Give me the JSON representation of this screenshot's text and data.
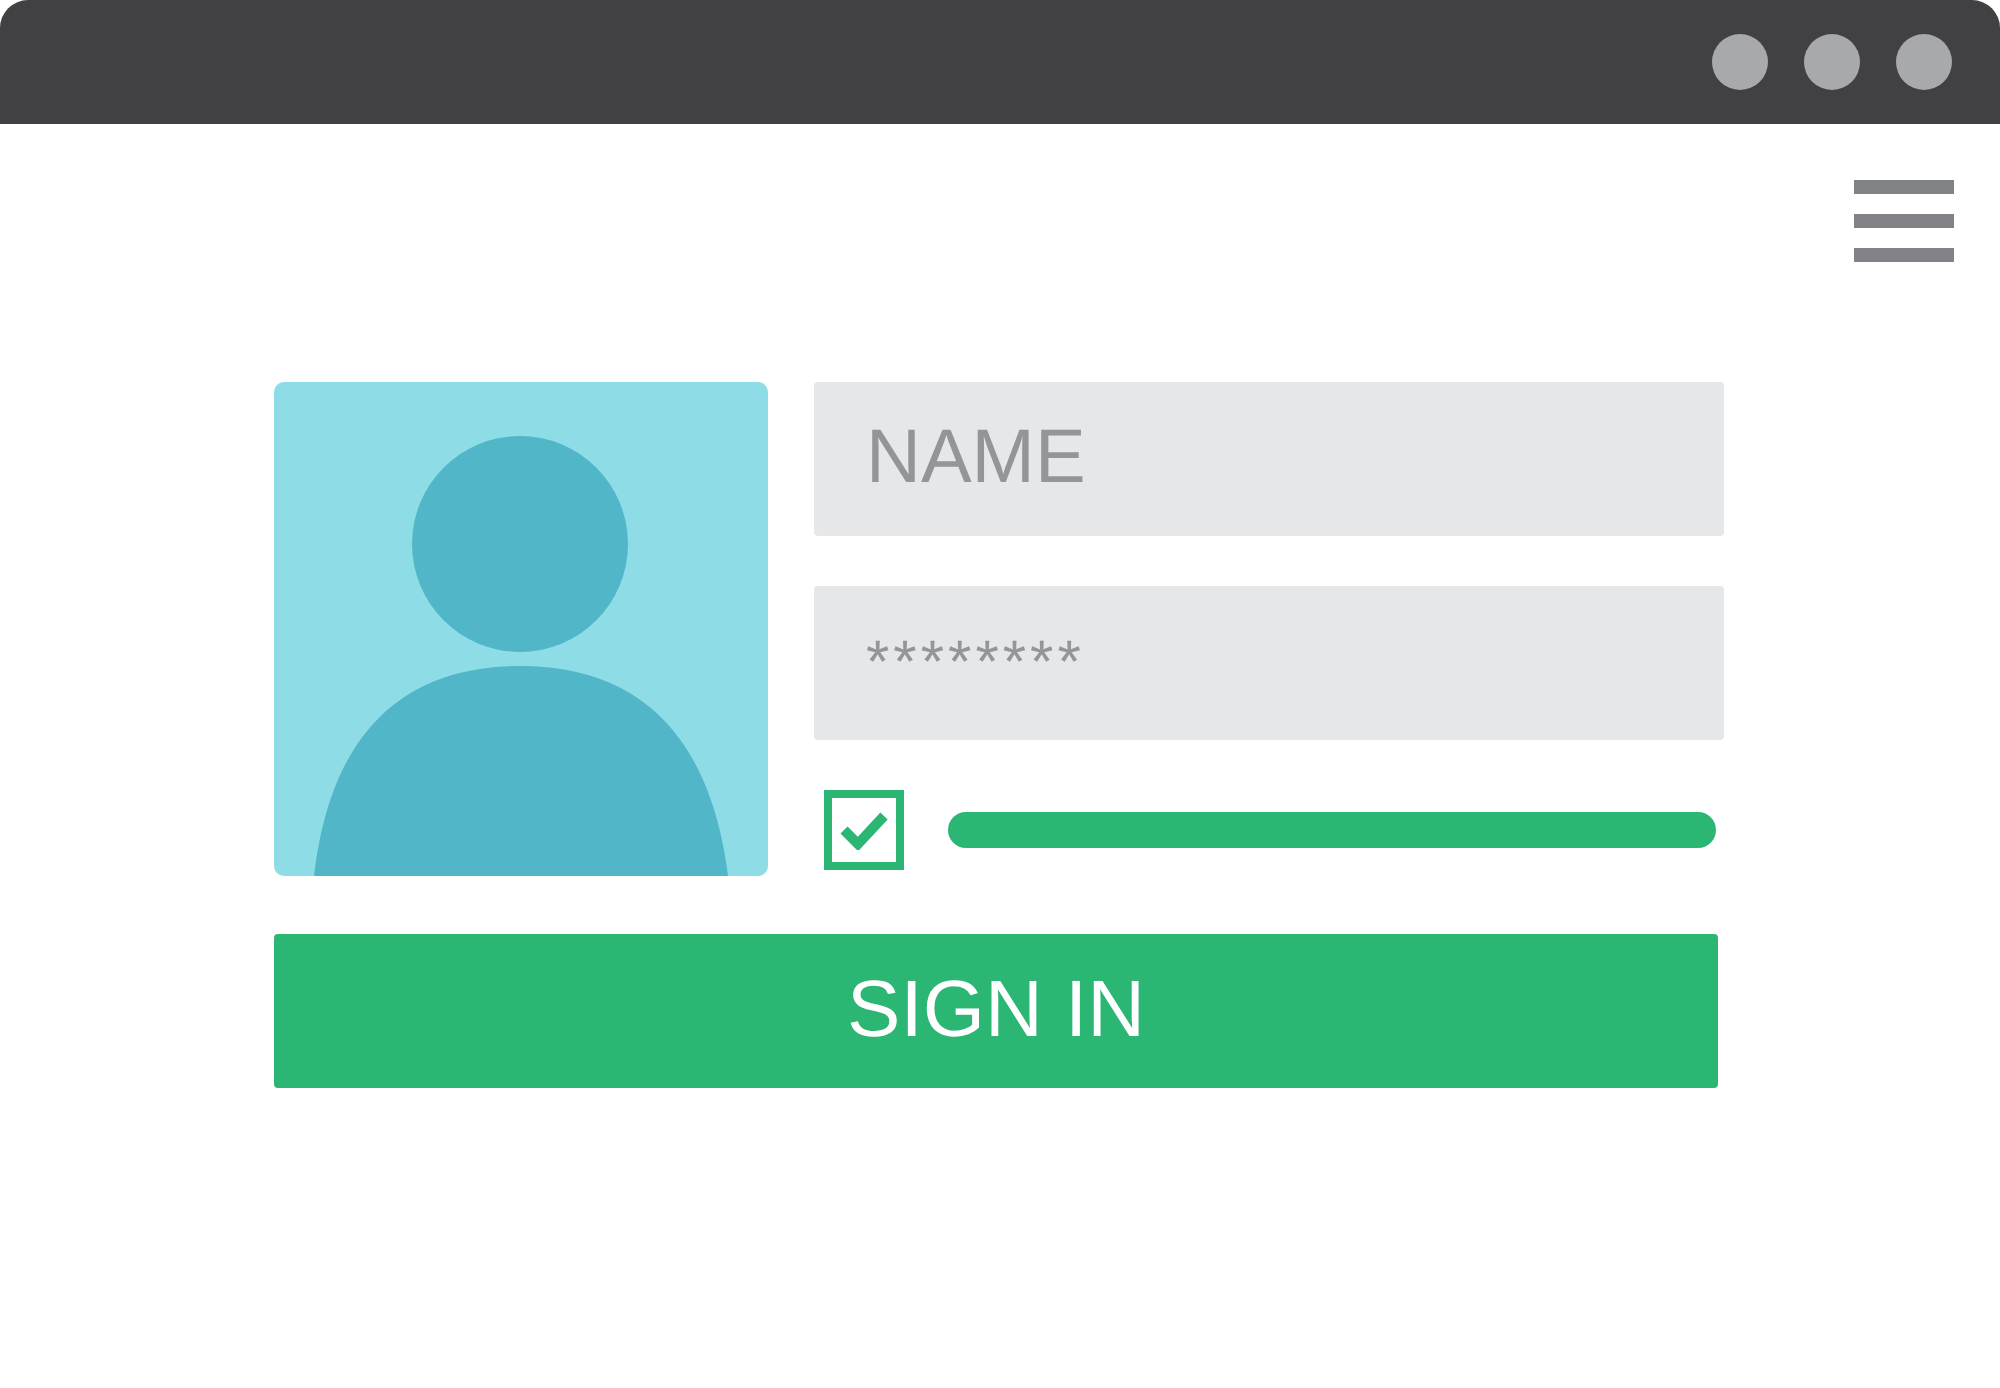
{
  "fields": [
    {
      "kind": "text",
      "placeholder": "NAME"
    },
    {
      "kind": "password",
      "placeholder": "********"
    }
  ],
  "remember": {
    "checked": true
  },
  "sign_in_button": {
    "label": "SIGN IN"
  }
}
